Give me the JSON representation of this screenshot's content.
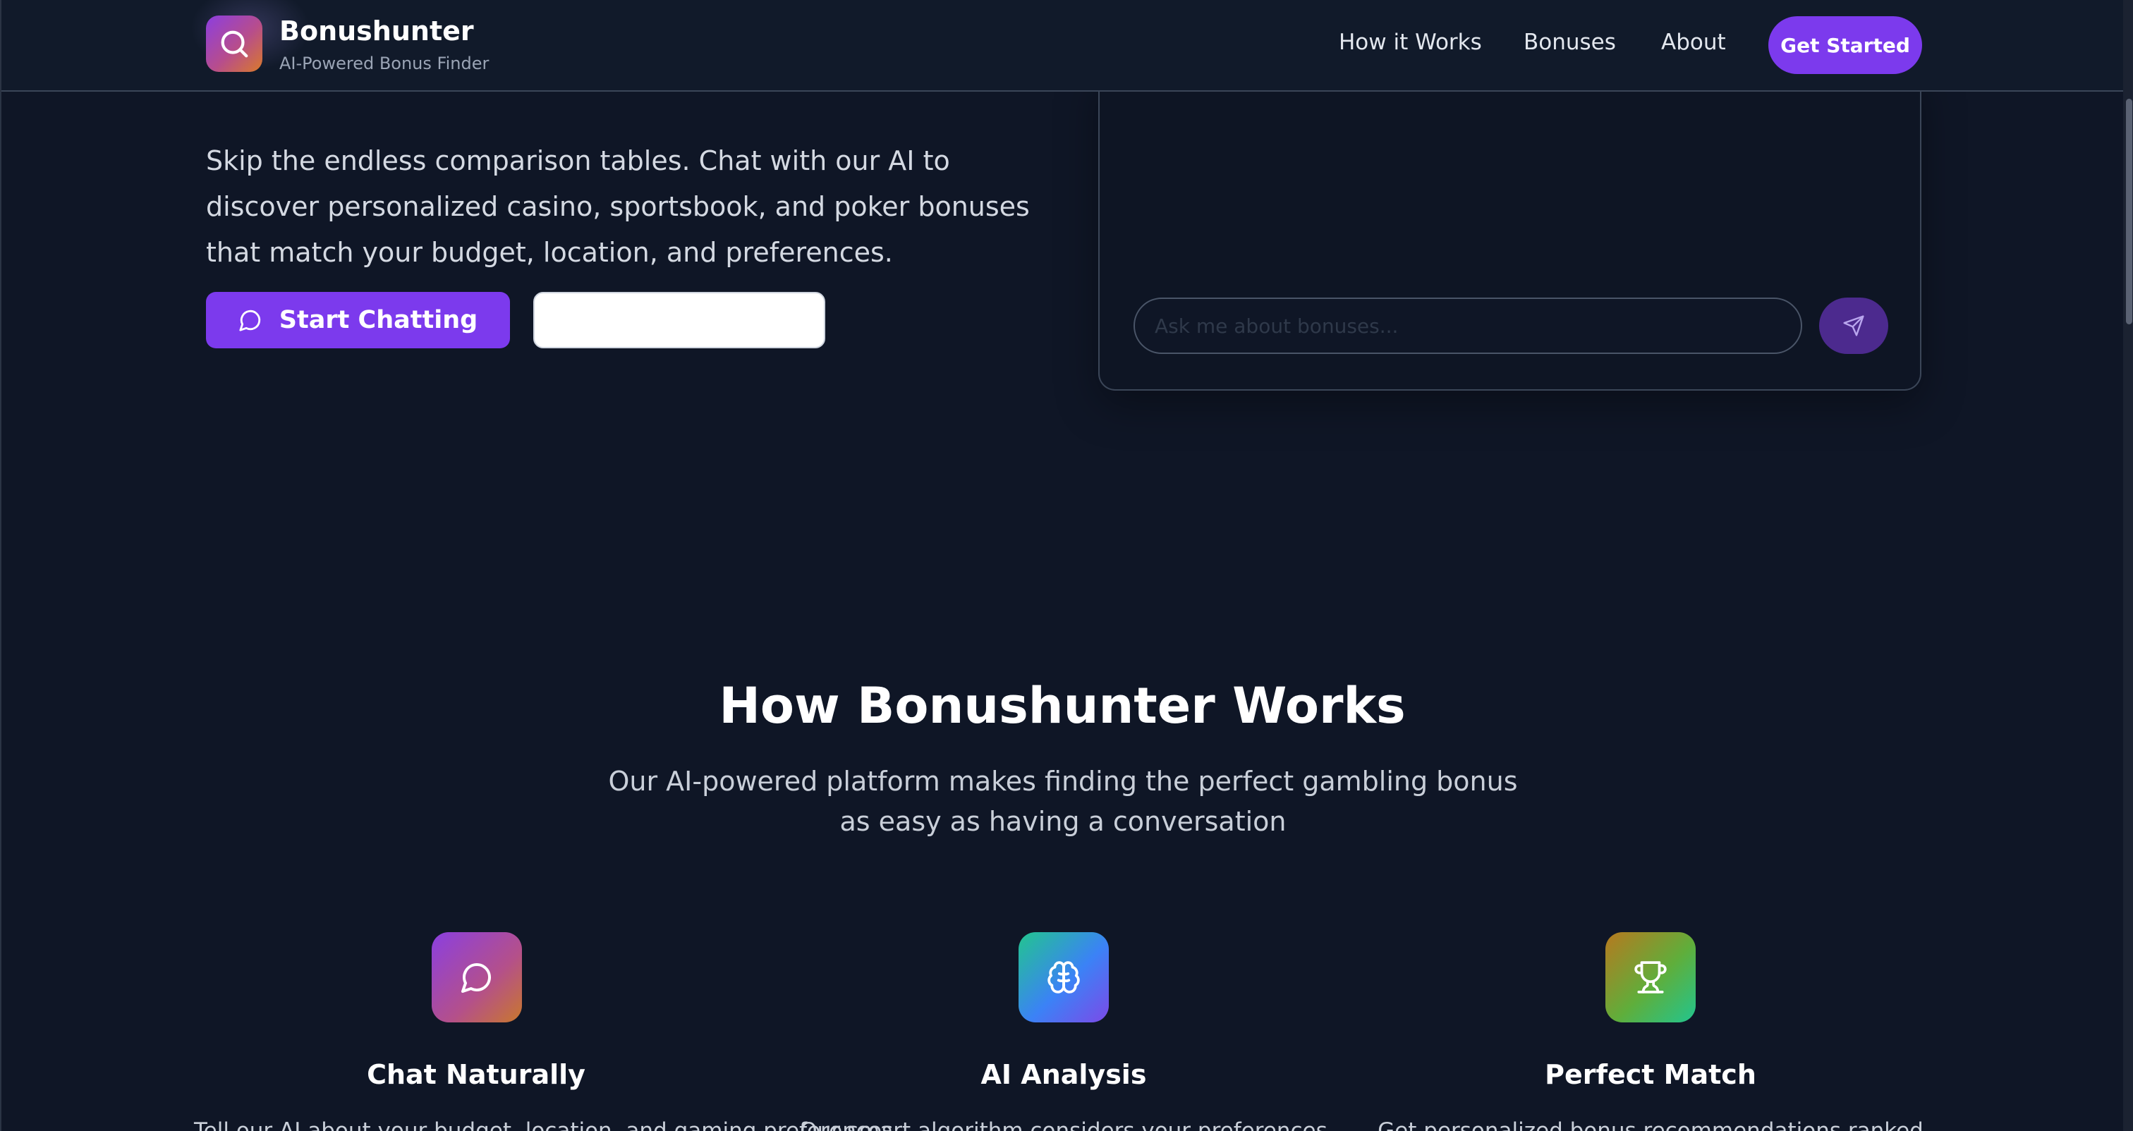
{
  "nav": {
    "brand_name": "Bonushunter",
    "brand_tagline": "AI-Powered Bonus Finder",
    "links": [
      "How it Works",
      "Bonuses",
      "About"
    ],
    "cta_label": "Get Started"
  },
  "hero": {
    "description": "Skip the endless comparison tables. Chat with our AI to discover personalized casino, sportsbook, and poker bonuses that match your budget, location, and preferences.",
    "primary_button_label": "Start Chatting",
    "secondary_button_label": ""
  },
  "chat": {
    "input_placeholder": "Ask me about bonuses..."
  },
  "how_it_works": {
    "title": "How Bonushunter Works",
    "subtitle": "Our AI-powered platform makes finding the perfect gambling bonus as easy as having a conversation",
    "features": [
      {
        "title": "Chat Naturally",
        "icon": "chat-bubble-icon",
        "description": "Tell our AI about your budget, location, and gaming preferences"
      },
      {
        "title": "AI Analysis",
        "icon": "brain-icon",
        "description": "Our smart algorithm considers your preferences"
      },
      {
        "title": "Perfect Match",
        "icon": "trophy-icon",
        "description": "Get personalized bonus recommendations ranked"
      }
    ]
  },
  "colors": {
    "background": "#0f1626",
    "accent": "#7c3aed"
  }
}
